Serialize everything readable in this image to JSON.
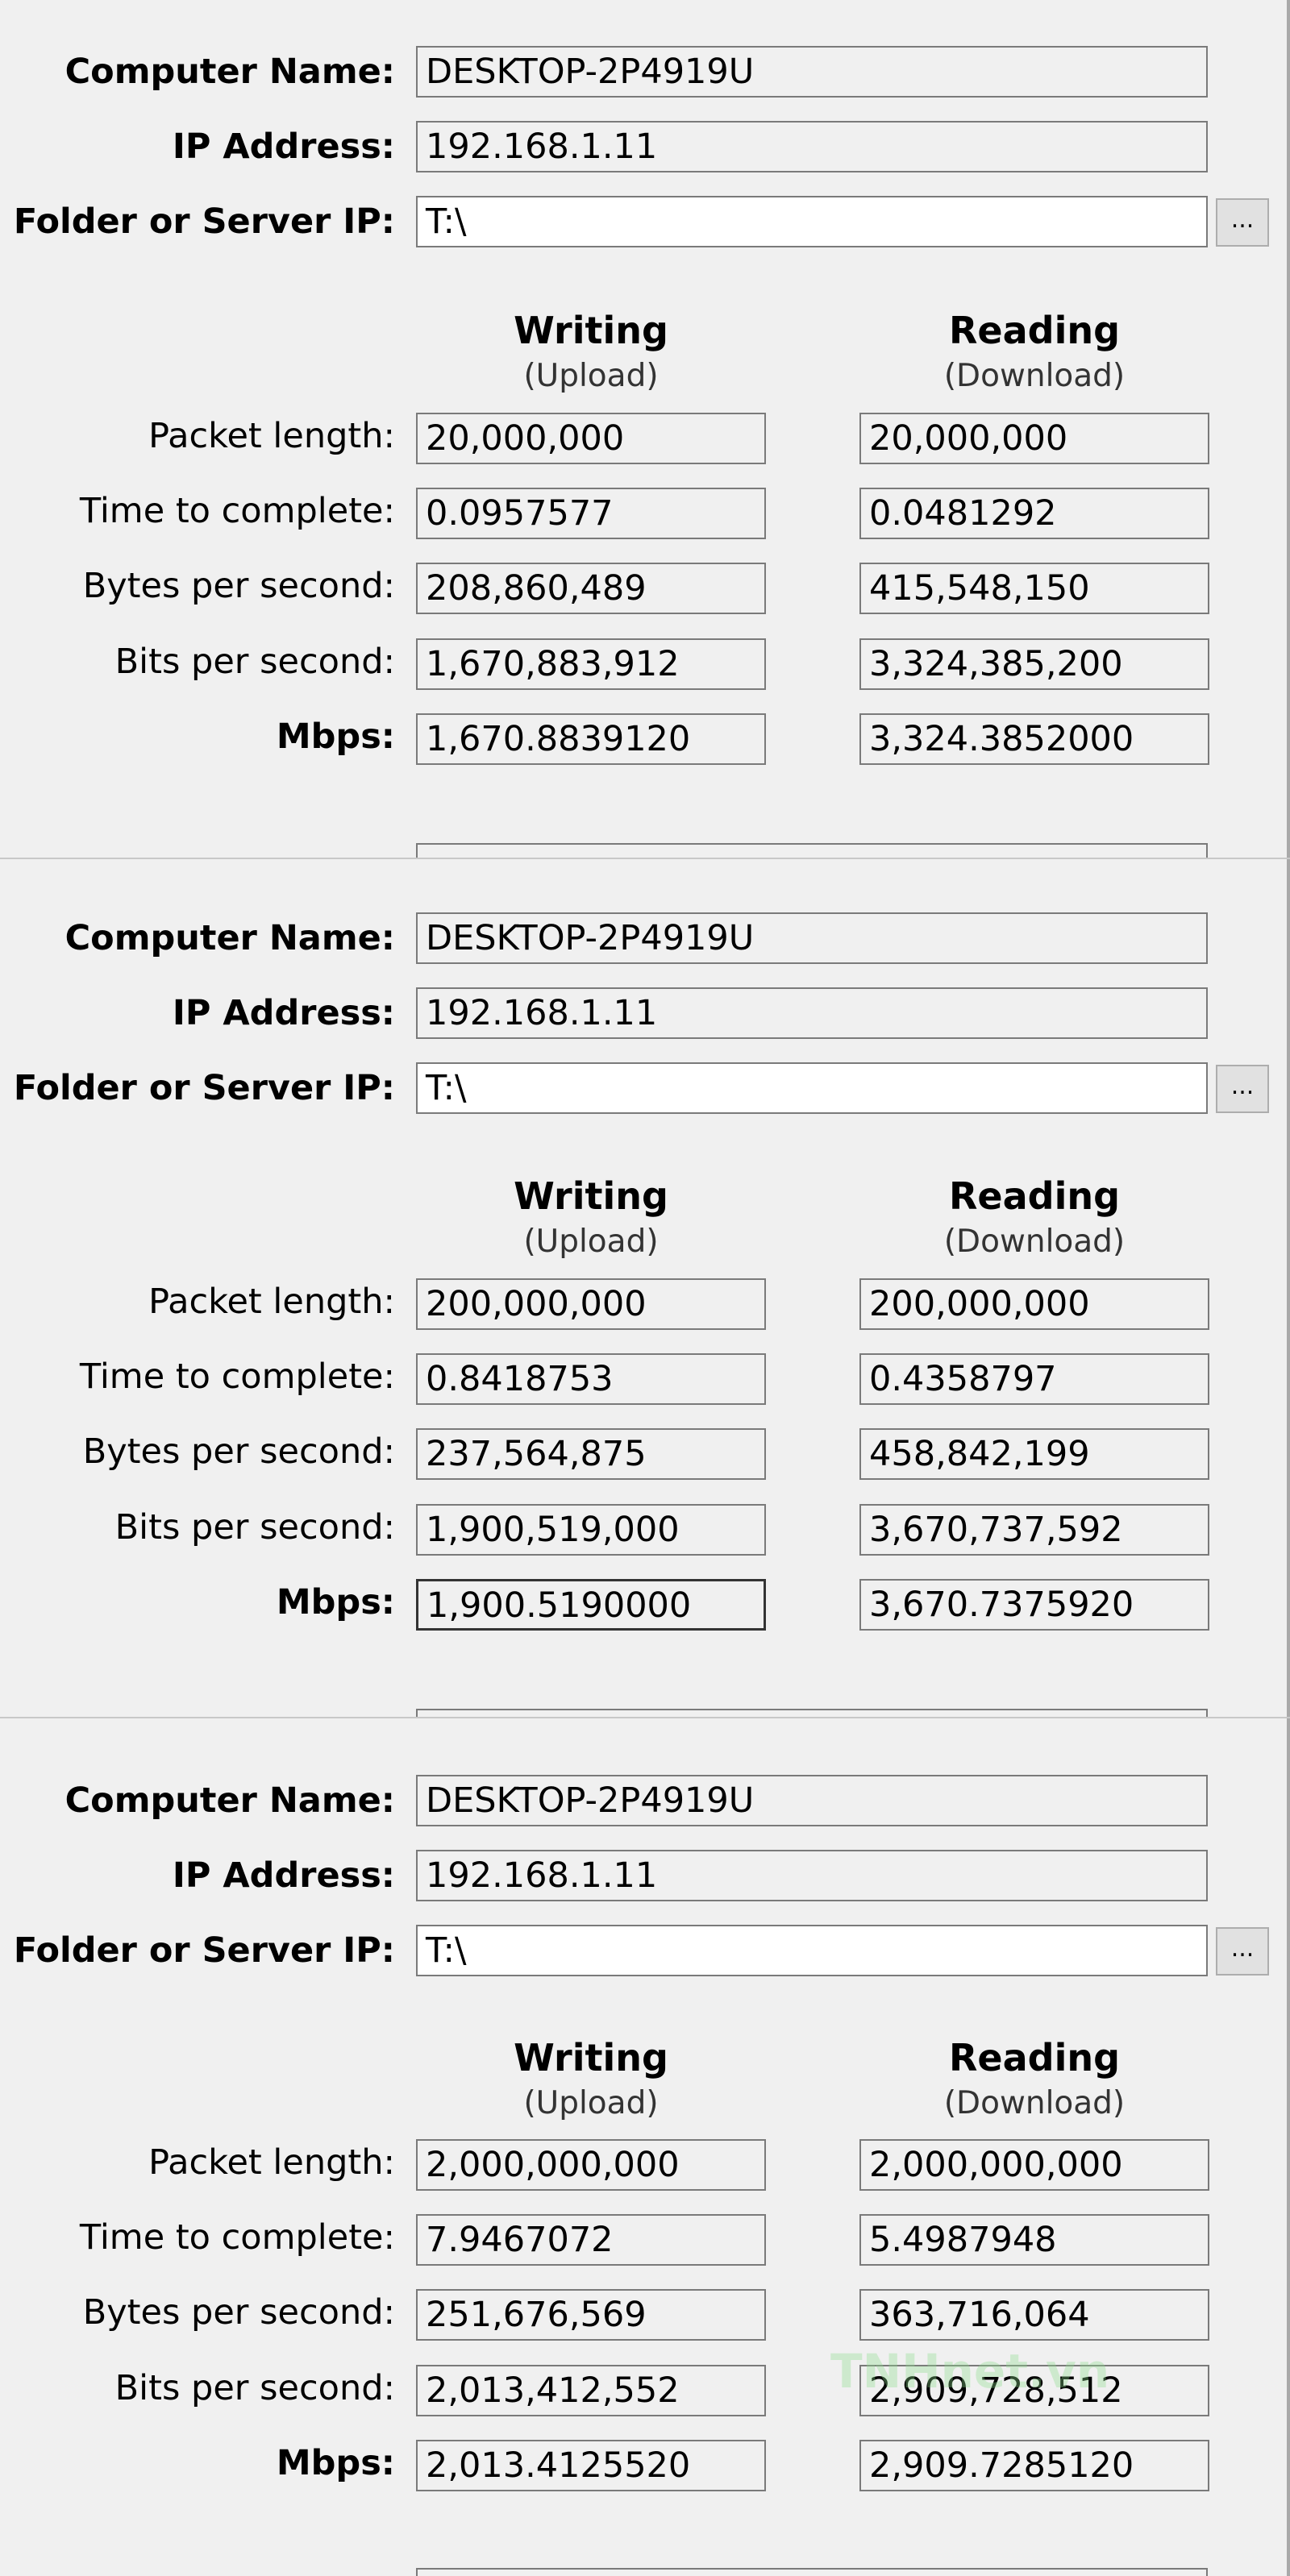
{
  "labels": {
    "computer_name": "Computer Name:",
    "ip_address": "IP Address:",
    "folder": "Folder or Server IP:",
    "packet_length": "Packet length:",
    "time_to_complete": "Time to complete:",
    "bytes_per_second": "Bytes per second:",
    "bits_per_second": "Bits per second:",
    "mbps": "Mbps:",
    "writing": "Writing",
    "upload": "(Upload)",
    "reading": "Reading",
    "download": "(Download)",
    "browse": "..."
  },
  "watermark": "TNHnet.vn",
  "panels": [
    {
      "computer_name": "DESKTOP-2P4919U",
      "ip_address": "192.168.1.11",
      "folder": "T:\\",
      "writing": {
        "packet_length": "20,000,000",
        "time_to_complete": "0.0957577",
        "bytes_per_second": "208,860,489",
        "bits_per_second": "1,670,883,912",
        "mbps": "1,670.8839120"
      },
      "reading": {
        "packet_length": "20,000,000",
        "time_to_complete": "0.0481292",
        "bytes_per_second": "415,548,150",
        "bits_per_second": "3,324,385,200",
        "mbps": "3,324.3852000"
      }
    },
    {
      "computer_name": "DESKTOP-2P4919U",
      "ip_address": "192.168.1.11",
      "folder": "T:\\",
      "writing": {
        "packet_length": "200,000,000",
        "time_to_complete": "0.8418753",
        "bytes_per_second": "237,564,875",
        "bits_per_second": "1,900,519,000",
        "mbps": "1,900.5190000"
      },
      "reading": {
        "packet_length": "200,000,000",
        "time_to_complete": "0.4358797",
        "bytes_per_second": "458,842,199",
        "bits_per_second": "3,670,737,592",
        "mbps": "3,670.7375920"
      }
    },
    {
      "computer_name": "DESKTOP-2P4919U",
      "ip_address": "192.168.1.11",
      "folder": "T:\\",
      "writing": {
        "packet_length": "2,000,000,000",
        "time_to_complete": "7.9467072",
        "bytes_per_second": "251,676,569",
        "bits_per_second": "2,013,412,552",
        "mbps": "2,013.4125520"
      },
      "reading": {
        "packet_length": "2,000,000,000",
        "time_to_complete": "5.4987948",
        "bytes_per_second": "363,716,064",
        "bits_per_second": "2,909,728,512",
        "mbps": "2,909.7285120"
      }
    }
  ]
}
